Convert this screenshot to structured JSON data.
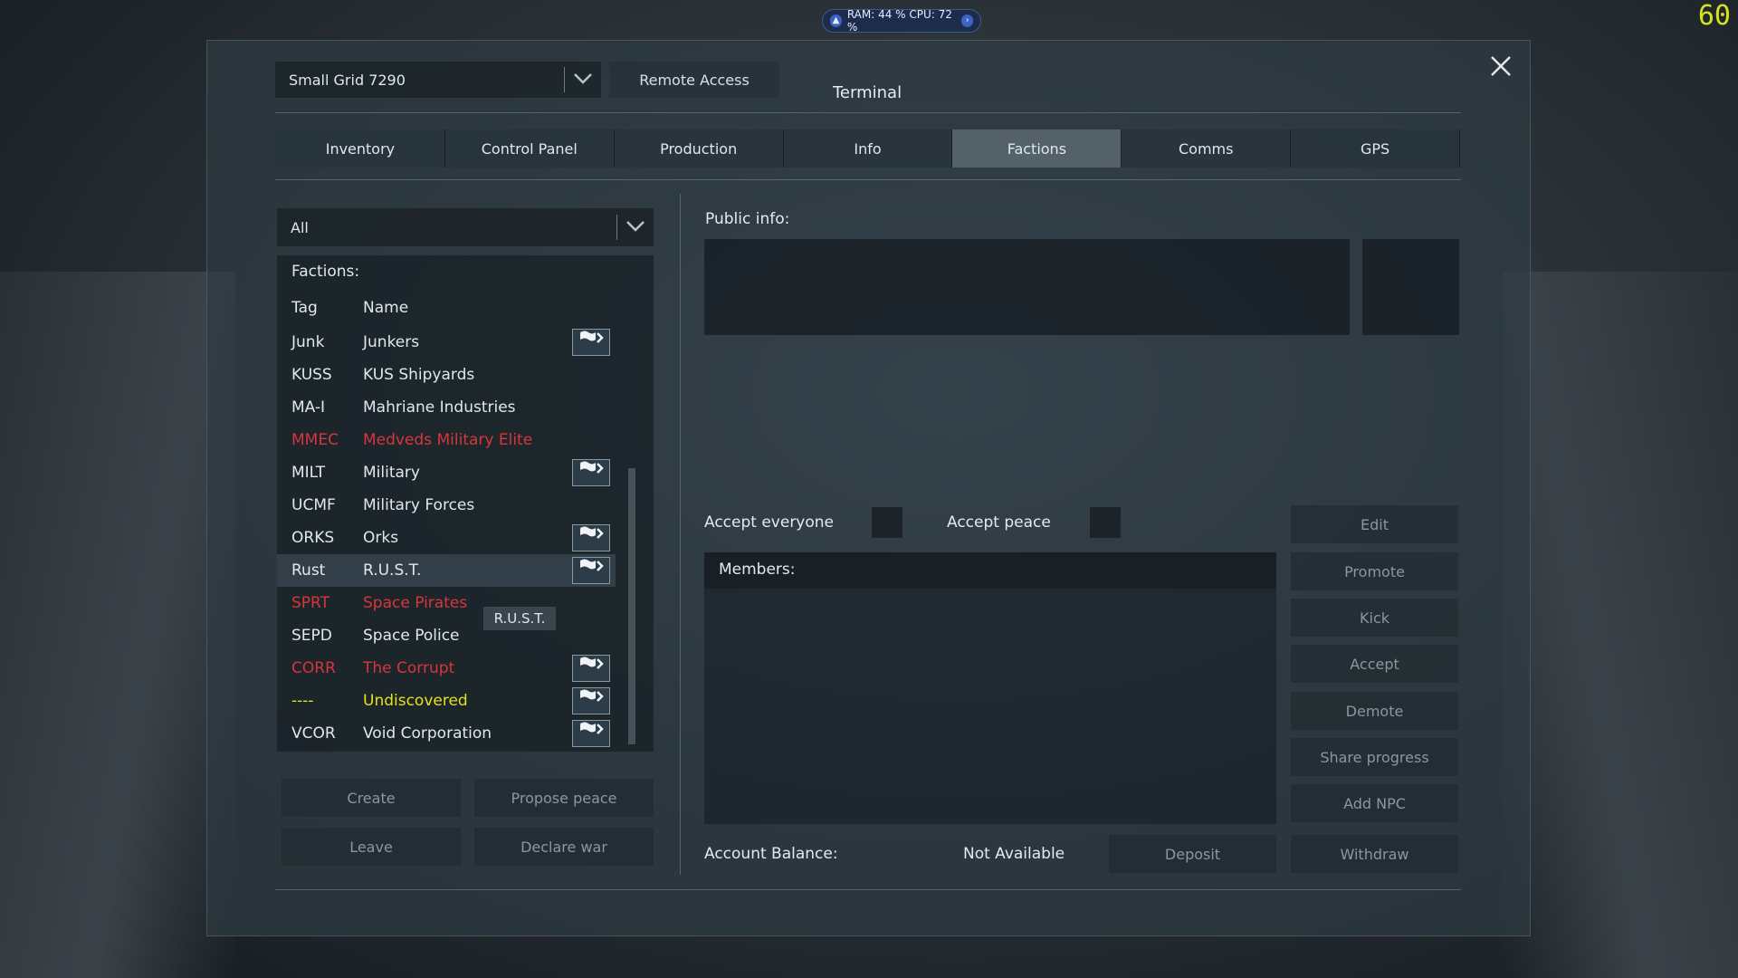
{
  "hud": {
    "perf_text": "RAM: 44 %  CPU: 72 %",
    "fps": "60"
  },
  "window": {
    "grid_select": "Small Grid 7290",
    "remote_access": "Remote Access",
    "title": "Terminal",
    "close_icon": "close-icon"
  },
  "tabs": [
    {
      "label": "Inventory"
    },
    {
      "label": "Control Panel"
    },
    {
      "label": "Production"
    },
    {
      "label": "Info"
    },
    {
      "label": "Factions",
      "active": true
    },
    {
      "label": "Comms"
    },
    {
      "label": "GPS"
    }
  ],
  "factions": {
    "filter": "All",
    "header": "Factions:",
    "col_tag": "Tag",
    "col_name": "Name",
    "rows": [
      {
        "tag": "Junk",
        "name": "Junkers",
        "flag": true,
        "color": "#dfe8ee"
      },
      {
        "tag": "KUSS",
        "name": "KUS Shipyards",
        "flag": false,
        "color": "#dfe8ee"
      },
      {
        "tag": "MA-I",
        "name": "Mahriane Industries",
        "flag": false,
        "color": "#dfe8ee"
      },
      {
        "tag": "MMEC",
        "name": "Medveds Military Elite",
        "flag": false,
        "color": "#d9353a"
      },
      {
        "tag": "MILT",
        "name": "Military",
        "flag": true,
        "color": "#dfe8ee"
      },
      {
        "tag": "UCMF",
        "name": "Military Forces",
        "flag": false,
        "color": "#dfe8ee"
      },
      {
        "tag": "ORKS",
        "name": "Orks",
        "flag": true,
        "color": "#dfe8ee"
      },
      {
        "tag": "Rust",
        "name": "R.U.S.T.",
        "flag": true,
        "color": "#dfe8ee",
        "selected": true
      },
      {
        "tag": "SPRT",
        "name": "Space Pirates",
        "flag": false,
        "color": "#d9353a"
      },
      {
        "tag": "SEPD",
        "name": "Space Police",
        "flag": false,
        "color": "#dfe8ee"
      },
      {
        "tag": "CORR",
        "name": "The Corrupt",
        "flag": true,
        "color": "#d9353a"
      },
      {
        "tag": "----",
        "name": "Undiscovered",
        "flag": true,
        "color": "#e3e21c"
      },
      {
        "tag": "VCOR",
        "name": "Void Corporation",
        "flag": true,
        "color": "#dfe8ee"
      }
    ],
    "tooltip": "R.U.S.T.",
    "buttons": {
      "create": "Create",
      "propose_peace": "Propose peace",
      "leave": "Leave",
      "declare_war": "Declare war"
    }
  },
  "details": {
    "public_info": "Public info:",
    "accept_everyone": "Accept everyone",
    "accept_peace": "Accept peace",
    "members": "Members:",
    "account_balance": "Account Balance:",
    "balance_value": "Not Available",
    "side_buttons": {
      "edit": "Edit",
      "promote": "Promote",
      "kick": "Kick",
      "accept": "Accept",
      "demote": "Demote",
      "share_progress": "Share progress",
      "add_npc": "Add NPC"
    },
    "deposit": "Deposit",
    "withdraw": "Withdraw"
  }
}
